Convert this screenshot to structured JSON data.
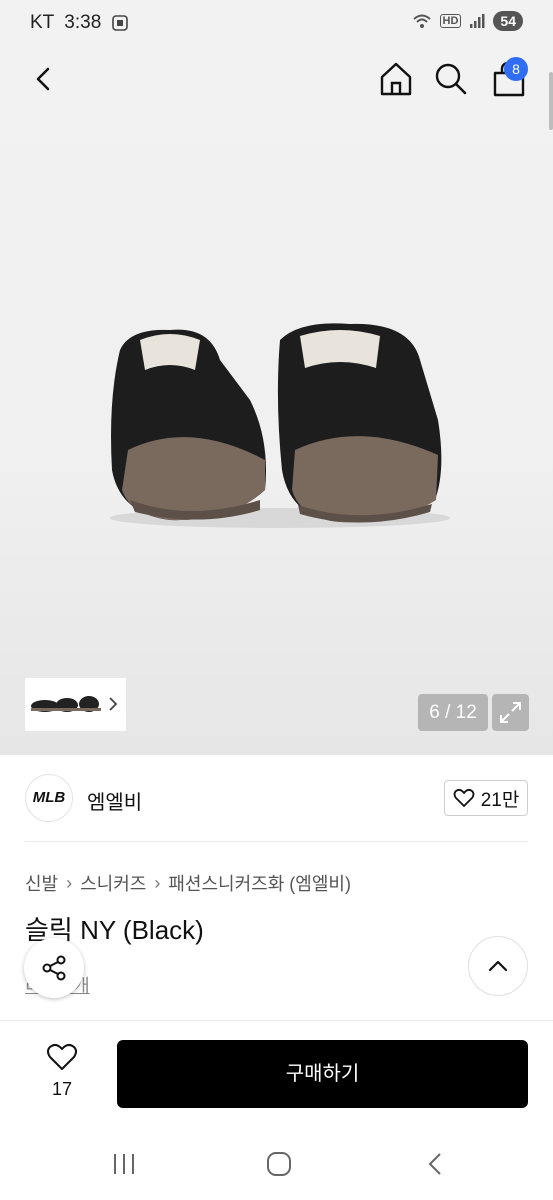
{
  "status_bar": {
    "carrier": "KT",
    "time": "3:38",
    "battery": "54",
    "hd": "HD"
  },
  "nav": {
    "cart_count": "8"
  },
  "gallery": {
    "position": "6 / 12"
  },
  "brand": {
    "logo_text": "MLB",
    "name": "엠엘비",
    "likes": "21만"
  },
  "breadcrumb": [
    "신발",
    "스니커즈",
    "패션스니커즈화 (엠엘비)"
  ],
  "product": {
    "title": "슬릭 NY (Black)",
    "review_text": "리뷰 6개"
  },
  "bottom": {
    "wish_count": "17",
    "buy_label": "구매하기"
  },
  "icons": [
    "back-icon",
    "home-icon",
    "search-icon",
    "cart-icon",
    "expand-icon",
    "heart-icon",
    "share-icon",
    "chevron-up-icon"
  ]
}
